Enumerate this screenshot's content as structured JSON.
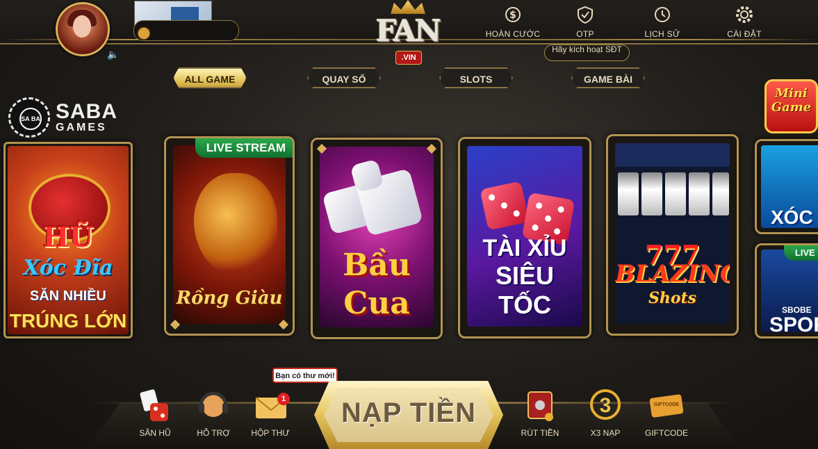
{
  "header": {
    "nav": [
      {
        "label": "HOÀN CƯỚC",
        "icon": "dollar-shield-icon"
      },
      {
        "label": "OTP",
        "icon": "shield-check-icon"
      },
      {
        "label": "LỊCH SỬ",
        "icon": "history-icon"
      },
      {
        "label": "CÀI ĐẶT",
        "icon": "gear-icon"
      }
    ],
    "activate_label": "Hãy kích hoạt SĐT",
    "logo_text": "FAN",
    "logo_domain": ".VIN"
  },
  "tabs": [
    {
      "label": "ALL GAME",
      "active": true
    },
    {
      "label": "QUAY SỐ",
      "active": false
    },
    {
      "label": "SLOTS",
      "active": false
    },
    {
      "label": "GAME BÀI",
      "active": false
    }
  ],
  "provider": {
    "name": "SABA",
    "sub": "GAMES",
    "emblem": "SA BA"
  },
  "mini_game": {
    "line1": "Mini",
    "line2": "Game"
  },
  "games": {
    "hu": {
      "line1": "HŨ",
      "line2": "Xóc Đĩa",
      "line3": "SĂN NHIỀU",
      "line4": "TRÚNG LỚN"
    },
    "rong": {
      "title": "Rồng Giàu",
      "badge": "LIVE STREAM"
    },
    "bau": {
      "line1": "Bầu",
      "line2": "Cua"
    },
    "tai": {
      "line1": "TÀI XỈU",
      "line2": "SIÊU TỐC"
    },
    "blaze": {
      "sevens": "777",
      "line1": "BLAZING",
      "line2": "Shots"
    },
    "xoc": {
      "title": "XÓC Đ"
    },
    "spo": {
      "badge": "LIVE S",
      "brand": "SBOBE",
      "title": "SPOR"
    }
  },
  "bottom": {
    "left": [
      {
        "label": "SĂN HŨ",
        "icon": "dice-cards-icon"
      },
      {
        "label": "HỖ TRỢ",
        "icon": "headset-icon"
      },
      {
        "label": "HỘP THƯ",
        "icon": "mail-icon"
      }
    ],
    "nap_label": "NẠP TIỀN",
    "right": [
      {
        "label": "RÚT TIỀN",
        "icon": "safe-icon"
      },
      {
        "label": "X3 NẠP",
        "icon": "x3-badge-icon",
        "glyph": "3"
      },
      {
        "label": "GIFTCODE",
        "icon": "ticket-icon",
        "ticket_text": "GIFTCODE"
      }
    ],
    "mail_tooltip": "Bạn có thư mới!",
    "mail_count": "1"
  },
  "colors": {
    "gold": "#d9b25a",
    "accent_red": "#c92a1a",
    "live_green": "#2aa84a"
  }
}
